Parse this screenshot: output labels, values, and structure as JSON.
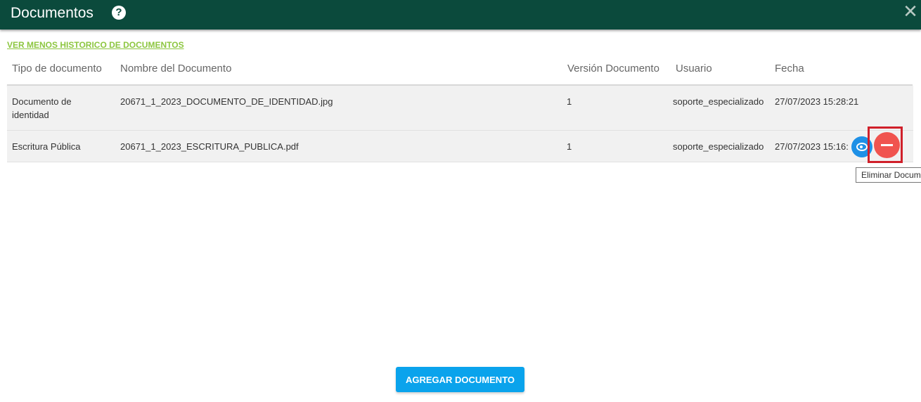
{
  "header": {
    "title": "Documentos",
    "help_glyph": "?",
    "close_glyph": "✕"
  },
  "history_link": "VER MENOS HISTORICO DE DOCUMENTOS",
  "table": {
    "columns": [
      "Tipo de documento",
      "Nombre del Documento",
      "Versión Documento",
      "Usuario",
      "Fecha"
    ],
    "rows": [
      {
        "type": "Documento de identidad",
        "name": "20671_1_2023_DOCUMENTO_DE_IDENTIDAD.jpg",
        "version": "1",
        "user": "soporte_especializado",
        "date": "27/07/2023 15:28:21"
      },
      {
        "type": "Escritura Pública",
        "name": "20671_1_2023_ESCRITURA_PUBLICA.pdf",
        "version": "1",
        "user": "soporte_especializado",
        "date": "27/07/2023 15:16:"
      }
    ]
  },
  "icons": {
    "view": "eye-icon",
    "delete": "minus-icon",
    "help": "question-icon",
    "close": "close-icon"
  },
  "tooltip": "Eliminar Documento",
  "add_button": "AGREGAR DOCUMENTO",
  "colors": {
    "header_bg": "#0b4a3c",
    "link": "#8cc63f",
    "primary_button": "#0aa3ec",
    "view_button": "#1e90e6",
    "delete_button": "#f0544f",
    "highlight_frame": "#d0202a"
  }
}
